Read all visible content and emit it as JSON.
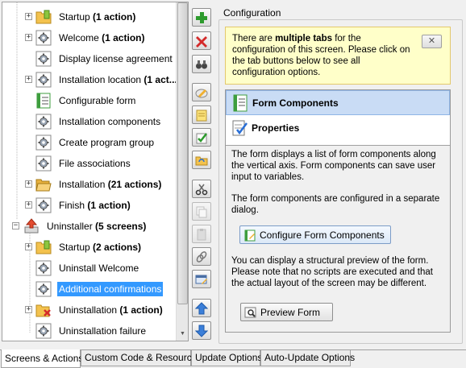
{
  "tree": {
    "items": [
      {
        "name": "Startup",
        "bold": " (1 action)",
        "icon": "folder-action-icon",
        "expandable": true,
        "indent": 1
      },
      {
        "name": "Welcome",
        "bold": " (1 action)",
        "icon": "gear-screen-icon",
        "expandable": true,
        "indent": 1
      },
      {
        "name": "Display license agreement",
        "bold": "",
        "icon": "gear-screen-icon",
        "expandable": false,
        "indent": 1
      },
      {
        "name": "Installation location",
        "bold": " (1 act...",
        "icon": "gear-screen-icon",
        "expandable": true,
        "indent": 1
      },
      {
        "name": "Configurable form",
        "bold": "",
        "icon": "form-icon",
        "expandable": false,
        "indent": 1
      },
      {
        "name": "Installation components",
        "bold": "",
        "icon": "gear-screen-icon",
        "expandable": false,
        "indent": 1
      },
      {
        "name": "Create program group",
        "bold": "",
        "icon": "gear-screen-icon",
        "expandable": false,
        "indent": 1
      },
      {
        "name": "File associations",
        "bold": "",
        "icon": "gear-screen-icon",
        "expandable": false,
        "indent": 1
      },
      {
        "name": "Installation",
        "bold": " (21 actions)",
        "icon": "folder-open-icon",
        "expandable": true,
        "indent": 1
      },
      {
        "name": "Finish",
        "bold": " (1 action)",
        "icon": "gear-screen-icon",
        "expandable": true,
        "indent": 1
      },
      {
        "name": "Uninstaller",
        "bold": " (5 screens)",
        "icon": "uninstaller-icon",
        "expandable": true,
        "expanded": true,
        "indent": 0
      },
      {
        "name": "Startup",
        "bold": " (2 actions)",
        "icon": "folder-action-icon",
        "expandable": true,
        "indent": 1
      },
      {
        "name": "Uninstall Welcome",
        "bold": "",
        "icon": "gear-screen-icon",
        "expandable": false,
        "indent": 1
      },
      {
        "name": "Additional confirmations",
        "bold": "",
        "icon": "gear-screen-icon",
        "expandable": false,
        "indent": 1,
        "selected": true
      },
      {
        "name": "Uninstallation",
        "bold": " (1 action)",
        "icon": "folder-delete-icon",
        "expandable": true,
        "indent": 1
      },
      {
        "name": "Uninstallation failure",
        "bold": "",
        "icon": "gear-screen-icon",
        "expandable": false,
        "indent": 1
      }
    ]
  },
  "toolbar": {
    "buttons": [
      "add-icon",
      "delete-icon",
      "find-icon",
      "rename-icon",
      "notes-icon",
      "check-icon",
      "folder-sync-icon",
      "cut-icon",
      "copy-icon",
      "paste-icon",
      "link-icon",
      "edit-screen-icon",
      "move-up-icon",
      "move-down-icon"
    ]
  },
  "config": {
    "title": "Configuration",
    "info_pre": "There are ",
    "info_bold": "multiple tabs",
    "info_post": " for the configuration of this screen. Please click on the tab buttons below to see all configuration options.",
    "close_label": "✕",
    "tabs": [
      {
        "label": "Form Components",
        "icon": "form-components-icon"
      },
      {
        "label": "Properties",
        "icon": "properties-icon"
      }
    ],
    "desc1": "The form displays a list of form components along the vertical axis. Form components can save user input to variables.",
    "desc2": "The form components are configured in a separate dialog.",
    "configure_button": "Configure Form Components",
    "desc3": "You can display a structural preview of the form. Please note that no scripts are executed and that the actual layout of the screen may be different.",
    "preview_button": "Preview Form"
  },
  "bottom_tabs": [
    {
      "label": "Screens & Actions",
      "active": true
    },
    {
      "label": "Custom Code & Resources",
      "active": false
    },
    {
      "label": "Update Options",
      "active": false
    },
    {
      "label": "Auto-Update Options",
      "active": false
    }
  ],
  "colors": {
    "selection": "#3399ff",
    "info_bg": "#ffffc9",
    "active_tab": "#c9dcf5"
  }
}
